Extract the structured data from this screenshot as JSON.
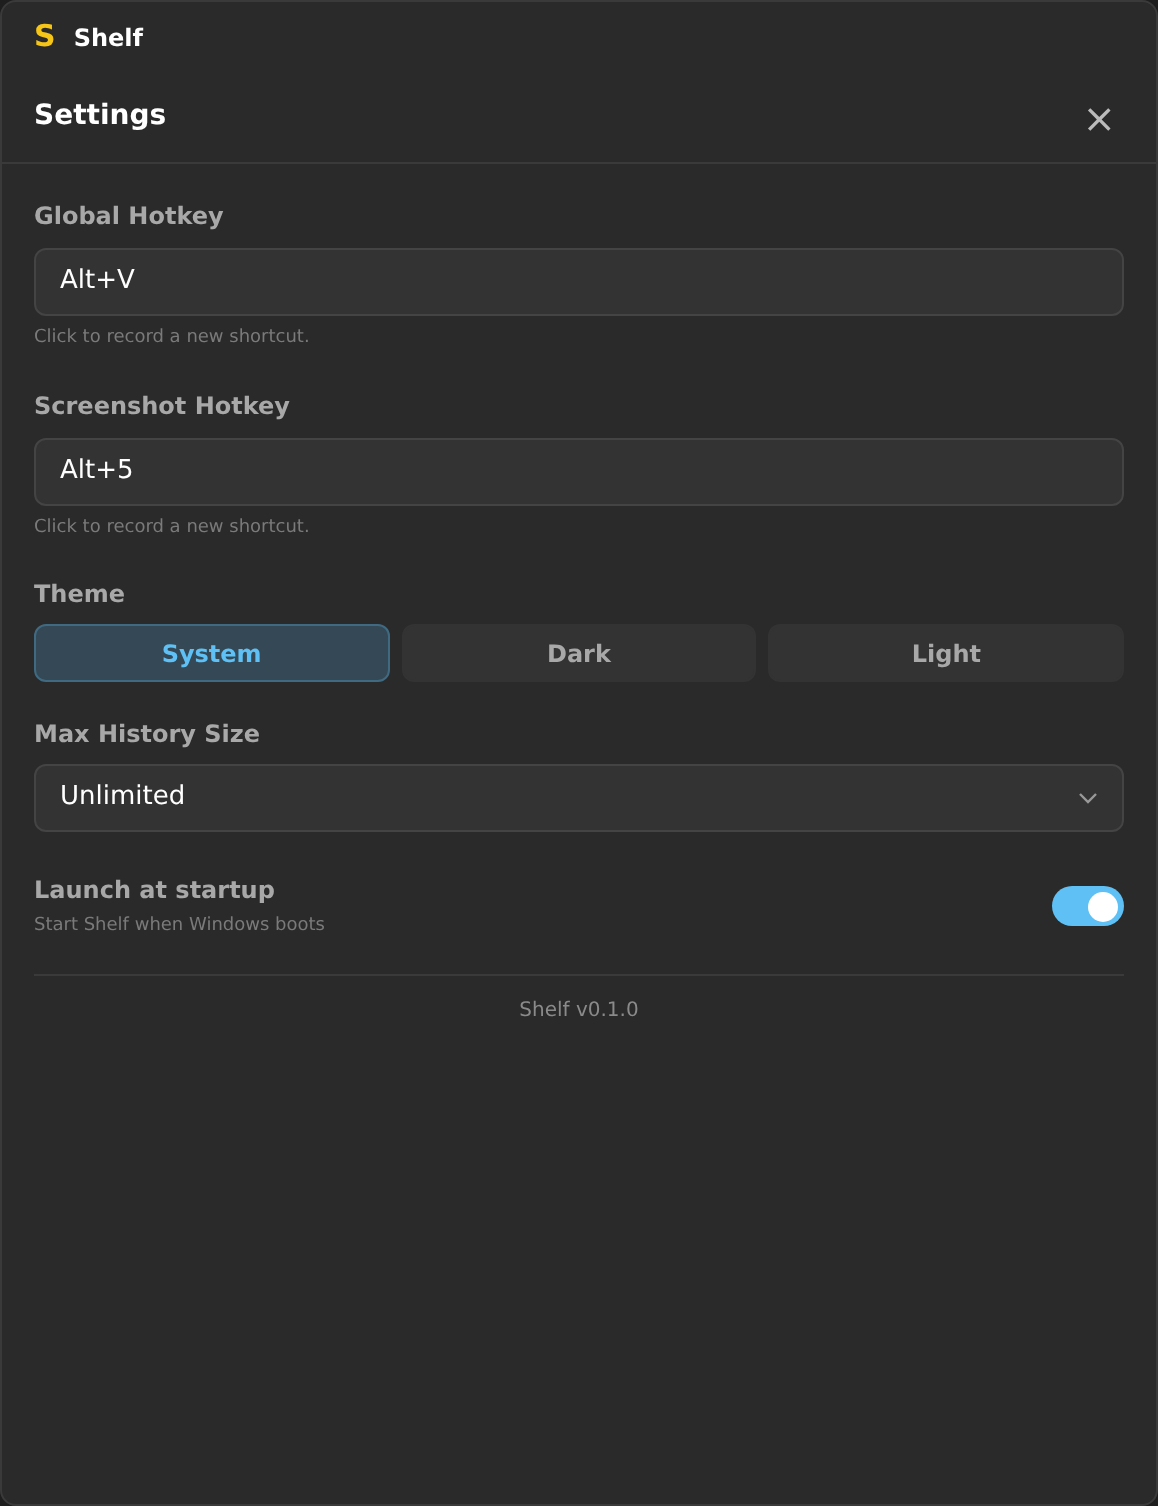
{
  "app": {
    "logo": "S",
    "title": "Shelf"
  },
  "dialog": {
    "title": "Settings",
    "close": "×"
  },
  "hotkeys": [
    {
      "label": "Global Hotkey",
      "value": "Alt+V",
      "hint": "Click to record a new shortcut."
    },
    {
      "label": "Screenshot Hotkey",
      "value": "Alt+5",
      "hint": "Click to record a new shortcut."
    }
  ],
  "theme": {
    "label": "Theme",
    "options": [
      {
        "label": "System",
        "selected": true
      },
      {
        "label": "Dark",
        "selected": false
      },
      {
        "label": "Light",
        "selected": false
      }
    ]
  },
  "history": {
    "label": "Max History Size",
    "value": "Unlimited"
  },
  "startup": {
    "label": "Launch at startup",
    "description": "Start Shelf when Windows boots",
    "on": true
  },
  "version": "Shelf v0.1.0"
}
